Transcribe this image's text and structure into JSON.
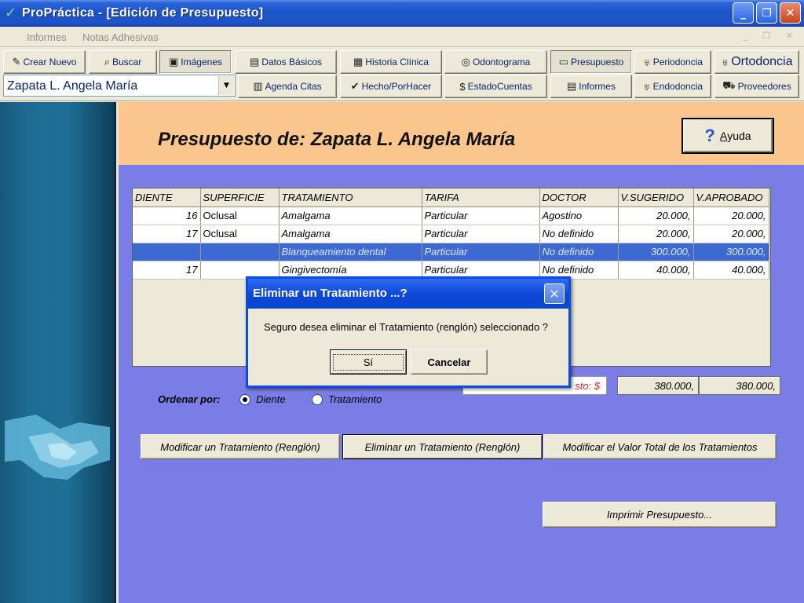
{
  "window": {
    "title": "ProPráctica - [Edición de Presupuesto]",
    "minimize_glyph": "_",
    "restore_glyph": "❐",
    "close_glyph": "✕"
  },
  "menu": {
    "items": [
      "Informes",
      "Notas Adhesivas"
    ],
    "mdi_controls": "_ ❐ ✕"
  },
  "toolbar": {
    "crear_nuevo": "Crear Nuevo",
    "buscar": "Buscar",
    "imagenes": "Imágenes",
    "datos_basicos": "Datos Básicos",
    "historia_clinica": "Historia Clínica",
    "odontograma": "Odontograma",
    "presupuesto": "Presupuesto",
    "periodoncia": "Periodoncia",
    "ortodoncia": "Ortodoncia",
    "agenda_citas": "Agenda Citas",
    "hecho_por_hacer": "Hecho/PorHacer",
    "estado_cuentas": "EstadoCuentas",
    "informes": "Informes",
    "endodoncia": "Endodoncia",
    "proveedores": "Proveedores"
  },
  "patient_select": {
    "value": "Zapata L. Angela María"
  },
  "page": {
    "title": "Presupuesto de: Zapata L. Angela María",
    "help_icon": "?",
    "help_label_accel": "A",
    "help_label_rest": "yuda"
  },
  "grid": {
    "headers": [
      "DIENTE",
      "SUPERFICIE",
      "TRATAMIENTO",
      "TARIFA",
      "DOCTOR",
      "V.SUGERIDO",
      "V.APROBADO"
    ],
    "rows": [
      {
        "diente": "16",
        "superficie": "Oclusal",
        "tratamiento": "Amalgama",
        "tarifa": "Particular",
        "doctor": "Agostino",
        "v_sugerido": "20.000,",
        "v_aprobado": "20.000,"
      },
      {
        "diente": "17",
        "superficie": "Oclusal",
        "tratamiento": "Amalgama",
        "tarifa": "Particular",
        "doctor": "No definido",
        "v_sugerido": "20.000,",
        "v_aprobado": "20.000,"
      },
      {
        "diente": "",
        "superficie": "",
        "tratamiento": "Blanqueamiento dental",
        "tarifa": "Particular",
        "doctor": "No definido",
        "v_sugerido": "300.000,",
        "v_aprobado": "300.000,"
      },
      {
        "diente": "17",
        "superficie": "",
        "tratamiento": "Gingivectomía",
        "tarifa": "Particular",
        "doctor": "No definido",
        "v_sugerido": "40.000,",
        "v_aprobado": "40.000,"
      }
    ],
    "selected_row": 2
  },
  "totals": {
    "label": "sto: $",
    "sugerido": "380.000,",
    "aprobado": "380.000,"
  },
  "sort": {
    "label": "Ordenar por:",
    "options": [
      "Diente",
      "Tratamiento"
    ],
    "selected": "Diente"
  },
  "actions": {
    "modificar": "Modificar un Tratamiento (Renglón)",
    "eliminar": "Eliminar un Tratamiento (Renglón)",
    "modificar_total": "Modificar el Valor Total de los Tratamientos",
    "imprimir": "Imprimir Presupuesto..."
  },
  "dialog": {
    "title": "Eliminar un Tratamiento ...?",
    "message": "Seguro desea eliminar el Tratamiento (renglón) seleccionado ?",
    "yes": "Sí",
    "cancel": "Cancelar",
    "close_glyph": "✕"
  },
  "colors": {
    "titlebar": "#1d53c8",
    "main_background": "#7b7de6",
    "header_band": "#fbc68e",
    "side_panel": "#1e6c93",
    "selected_row": "#3d6ad0",
    "total_label_text": "#e22222",
    "dialog_border": "#0a4be6"
  },
  "icons": {
    "crear_nuevo": "pen-icon",
    "buscar": "binoculars-icon",
    "imagenes": "camera-icon",
    "datos_basicos": "id-card-icon",
    "historia_clinica": "printer-icon",
    "odontograma": "teeth-icon",
    "presupuesto": "monitor-icon",
    "periodoncia": "tooth-icon",
    "ortodoncia": "tooth-icon",
    "agenda_citas": "calendar-icon",
    "hecho_por_hacer": "checkmark-icon",
    "estado_cuentas": "money-icon",
    "informes": "document-icon",
    "endodoncia": "tooth-icon",
    "proveedores": "truck-icon",
    "help": "question-icon",
    "side": "handshake-image"
  }
}
